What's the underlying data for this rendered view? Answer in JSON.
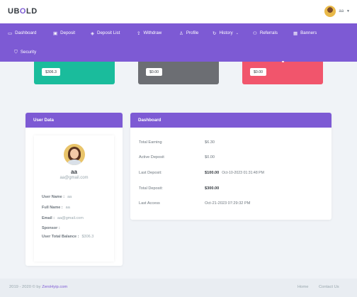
{
  "topbar": {
    "logo_u": "U",
    "logo_b": "B",
    "logo_o": "O",
    "logo_ld": "LD",
    "username": "aa"
  },
  "nav": {
    "items": [
      {
        "label": "Dashboard",
        "icon": "monitor-icon"
      },
      {
        "label": "Deposit",
        "icon": "wallet-icon"
      },
      {
        "label": "Deposit List",
        "icon": "layers-icon"
      },
      {
        "label": "Withdraw",
        "icon": "upload-icon"
      },
      {
        "label": "Profile",
        "icon": "user-plus-icon"
      },
      {
        "label": "History",
        "icon": "history-icon"
      },
      {
        "label": "Referrals",
        "icon": "users-icon"
      },
      {
        "label": "Banners",
        "icon": "grid-icon"
      },
      {
        "label": "Security",
        "icon": "shield-icon"
      }
    ]
  },
  "stats": {
    "card1_value": "$306.3",
    "card2_value": "$0.00",
    "card3_value": "$0.00"
  },
  "user_data": {
    "title": "User Data",
    "name": "aa",
    "email": "aa@gmail.com",
    "username_label": "User Name :",
    "username_value": "aa",
    "fullname_label": "Full Name :",
    "fullname_value": "aa",
    "email_label": "Email :",
    "email_value": "aa@gmail.com",
    "sponsor_label": "Sponsor :",
    "sponsor_value": "",
    "balance_label": "User Total Balance :",
    "balance_value": "$306.3"
  },
  "dashboard": {
    "title": "Dashboard",
    "rows": [
      {
        "label": "Total Earning",
        "value": "$6.30"
      },
      {
        "label": "Active Deposit",
        "value": "$0.00"
      },
      {
        "label": "Last Deposit:",
        "value": "$100.00",
        "date": "Oct-10-2023 01:31:48 PM"
      },
      {
        "label": "Total Deposit:",
        "value": "$300.00"
      },
      {
        "label": "Last Access",
        "value": "Oct-21-2023 07:29:32 PM"
      }
    ]
  },
  "footer": {
    "copy": "2019 - 2020 © by",
    "brand": "ZeroHyip.com",
    "home": "Home",
    "contact": "Contact Us"
  },
  "colors": {
    "primary": "#7d5ad4",
    "teal": "#1abc9c",
    "gray": "#6c6e73",
    "red": "#f1556c"
  }
}
